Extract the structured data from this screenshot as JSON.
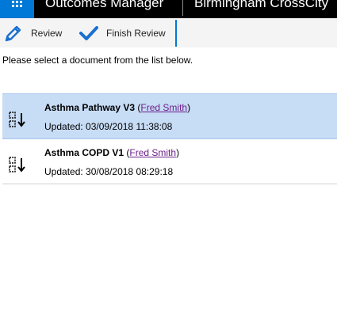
{
  "topbar": {
    "app_title": "Outcomes Manager",
    "environment_title": "Birmingham CrossCity",
    "waffle_icon": "app-launcher-icon",
    "accent_color": "#0078d7"
  },
  "commands": {
    "review_label": "Review",
    "review_icon": "pencil-icon",
    "finish_label": "Finish Review",
    "finish_icon": "checkmark-icon"
  },
  "content": {
    "instruction": "Please select a document from the list below."
  },
  "documents": [
    {
      "title": "Asthma Pathway V3",
      "paren_open": " (",
      "author": "Fred Smith",
      "paren_close": ")",
      "updated_prefix": "Updated: ",
      "updated": "03/09/2018 11:38:08",
      "selected": true,
      "icon": "sort-document-icon"
    },
    {
      "title": "Asthma COPD V1",
      "paren_open": " (",
      "author": "Fred Smith",
      "paren_close": ")",
      "updated_prefix": "Updated: ",
      "updated": "30/08/2018 08:29:18",
      "selected": false,
      "icon": "sort-document-icon"
    }
  ]
}
